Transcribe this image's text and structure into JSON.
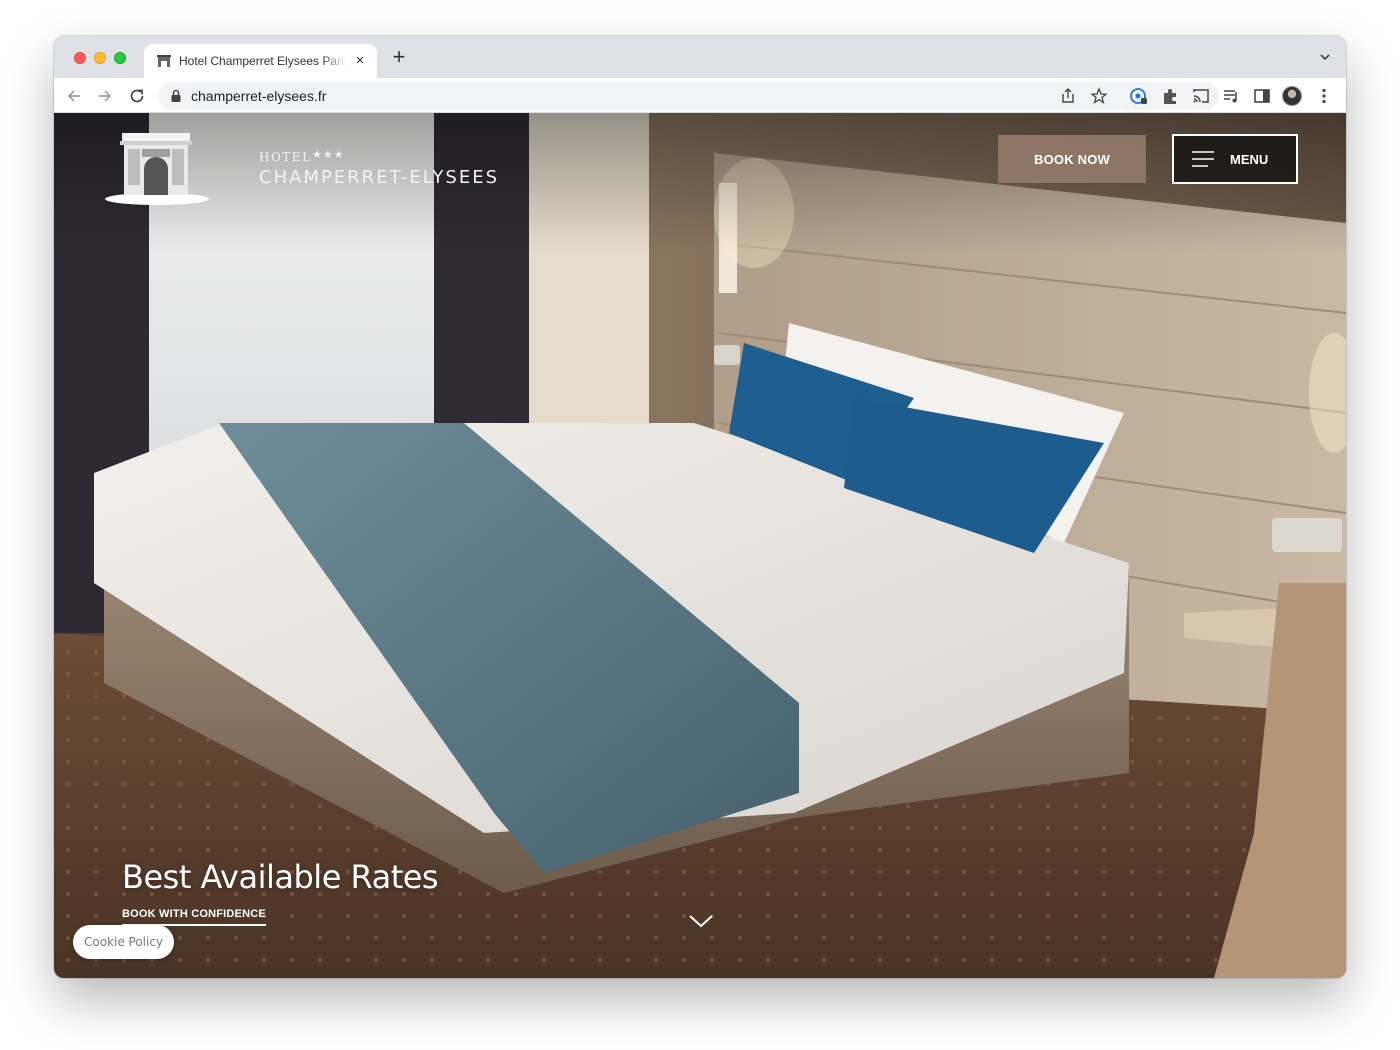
{
  "browser": {
    "tab_title": "Hotel Champerret Elysees Paris",
    "new_tab": "+",
    "close_tab": "×",
    "url": "champerret-elysees.fr"
  },
  "site": {
    "logo": {
      "hotel": "HOTEL",
      "stars": "★★★",
      "name": "CHAMPERRET-ELYSEES"
    },
    "header": {
      "book_now": "BOOK NOW",
      "menu": "MENU"
    },
    "hero": {
      "title": "Best Available Rates",
      "subtitle": "BOOK WITH CONFIDENCE",
      "image": "hotel-bedroom-photo"
    },
    "cookie": "Cookie Policy"
  },
  "colors": {
    "book_now_bg": "#927a6a",
    "menu_bg": "#141414",
    "tabstrip": "#dee1e6",
    "pillow_blue": "#1f5f8f",
    "throw_blue": "#5a7f8f"
  }
}
